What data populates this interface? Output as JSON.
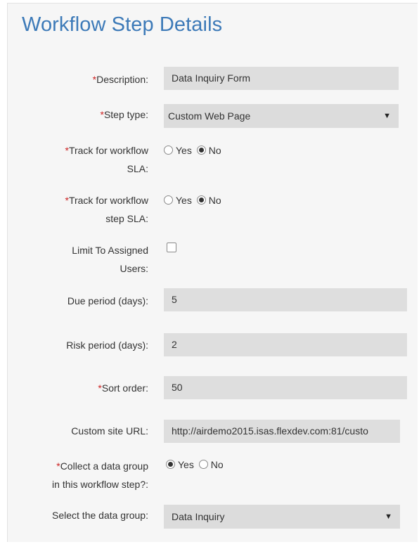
{
  "title": "Workflow Step Details",
  "required_marker": "*",
  "fields": {
    "description": {
      "label": "Description:",
      "value": "Data Inquiry Form"
    },
    "step_type": {
      "label": "Step type:",
      "value": "Custom Web Page"
    },
    "track_workflow_sla": {
      "label_line1": "Track for workflow",
      "label_line2": "SLA:",
      "yes": "Yes",
      "no": "No",
      "selected": "No"
    },
    "track_step_sla": {
      "label_line1": "Track for workflow",
      "label_line2": "step SLA:",
      "yes": "Yes",
      "no": "No",
      "selected": "No"
    },
    "limit_users": {
      "label_line1": "Limit To Assigned",
      "label_line2": "Users:",
      "checked": false
    },
    "due_period": {
      "label": "Due period (days):",
      "value": "5"
    },
    "risk_period": {
      "label": "Risk period (days):",
      "value": "2"
    },
    "sort_order": {
      "label": "Sort order:",
      "value": "50"
    },
    "custom_url": {
      "label": "Custom site URL:",
      "value": "http://airdemo2015.isas.flexdev.com:81/custo"
    },
    "collect_data_group": {
      "label_line1": "Collect a data group",
      "label_line2": "in this workflow step?:",
      "yes": "Yes",
      "no": "No",
      "selected": "Yes"
    },
    "data_group": {
      "label": "Select the data group:",
      "value": "Data Inquiry"
    }
  },
  "icons": {
    "dropdown": "caret-down-icon"
  }
}
